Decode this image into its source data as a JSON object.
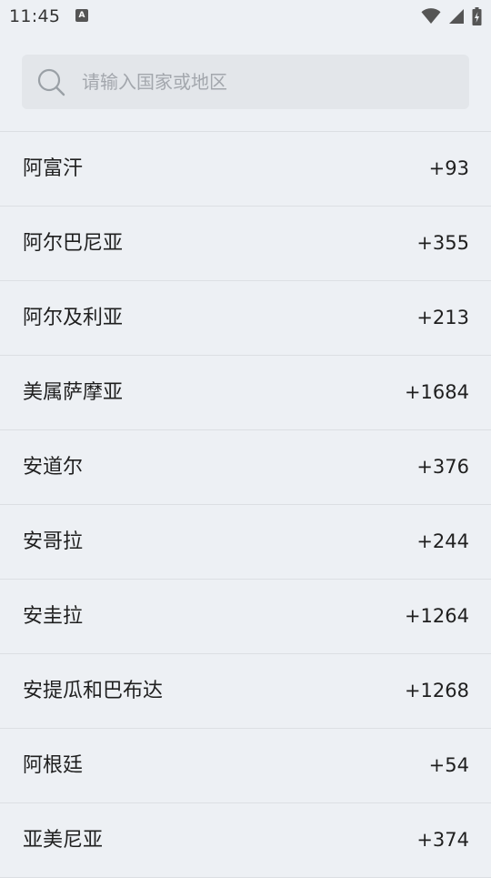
{
  "status_bar": {
    "time": "11:45",
    "notification_icon_letter": "A",
    "icons": [
      "wifi-icon",
      "cell-signal-icon",
      "battery-charging-icon"
    ]
  },
  "search": {
    "placeholder": "请输入国家或地区",
    "value": "",
    "icon": "search-icon"
  },
  "countries": [
    {
      "name": "阿富汗",
      "code": "+93"
    },
    {
      "name": "阿尔巴尼亚",
      "code": "+355"
    },
    {
      "name": "阿尔及利亚",
      "code": "+213"
    },
    {
      "name": "美属萨摩亚",
      "code": "+1684"
    },
    {
      "name": "安道尔",
      "code": "+376"
    },
    {
      "name": "安哥拉",
      "code": "+244"
    },
    {
      "name": "安圭拉",
      "code": "+1264"
    },
    {
      "name": "安提瓜和巴布达",
      "code": "+1268"
    },
    {
      "name": "阿根廷",
      "code": "+54"
    },
    {
      "name": "亚美尼亚",
      "code": "+374"
    }
  ],
  "colors": {
    "background": "#edf0f4",
    "search_background": "#e3e6ea",
    "divider": "#dcdfe3",
    "text": "#1f1f1f",
    "placeholder": "#a3a7ad"
  }
}
